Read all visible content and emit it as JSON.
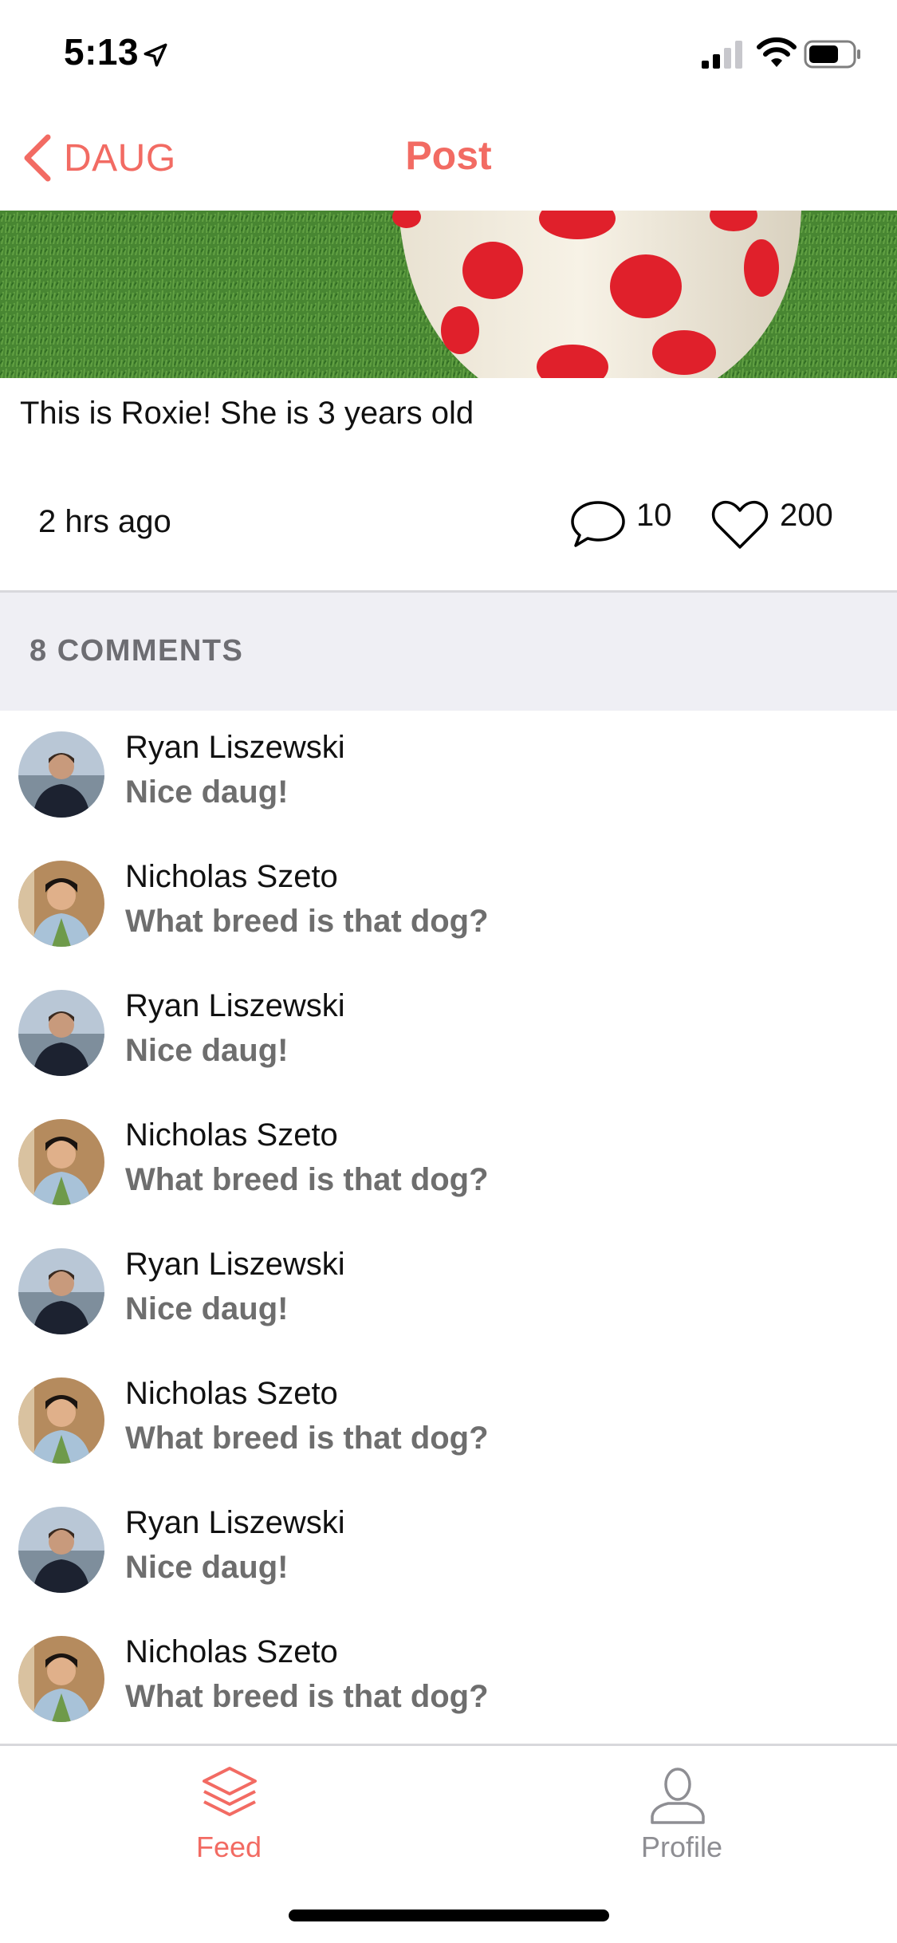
{
  "status_bar": {
    "time": "5:13",
    "icons": [
      "location-arrow-icon",
      "cellular-signal-icon",
      "wifi-icon",
      "battery-icon"
    ]
  },
  "nav": {
    "back_label": "DAUG",
    "title": "Post"
  },
  "post": {
    "caption": "This is Roxie! She is 3 years old",
    "time_ago": "2 hrs ago",
    "comment_count": "10",
    "like_count": "200"
  },
  "comments_section": {
    "header": "8 COMMENTS",
    "items": [
      {
        "author": "Ryan Liszewski",
        "text": "Nice daug!"
      },
      {
        "author": "Nicholas Szeto",
        "text": "What breed is that dog?"
      },
      {
        "author": "Ryan Liszewski",
        "text": "Nice daug!"
      },
      {
        "author": "Nicholas Szeto",
        "text": "What breed is that dog?"
      },
      {
        "author": "Ryan Liszewski",
        "text": "Nice daug!"
      },
      {
        "author": "Nicholas Szeto",
        "text": "What breed is that dog?"
      },
      {
        "author": "Ryan Liszewski",
        "text": "Nice daug!"
      },
      {
        "author": "Nicholas Szeto",
        "text": "What breed is that dog?"
      }
    ]
  },
  "tab_bar": {
    "feed_label": "Feed",
    "profile_label": "Profile",
    "active": "Feed"
  },
  "colors": {
    "accent": "#f26b63",
    "section_bg": "#efeff4",
    "secondary_text": "#6e6e6e",
    "inactive_tab": "#8e8e93"
  }
}
